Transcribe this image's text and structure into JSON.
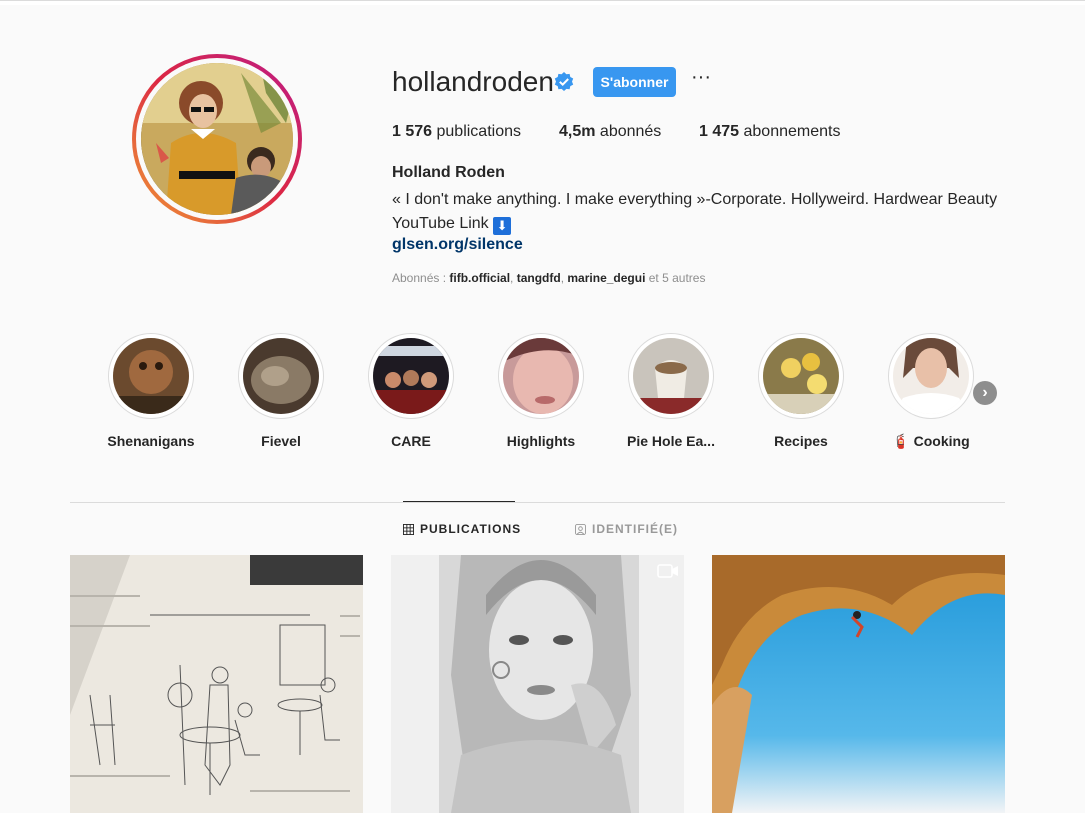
{
  "profile": {
    "username": "hollandroden",
    "follow_label": "S'abonner",
    "more_label": "···",
    "stats": {
      "posts_value": "1 576",
      "posts_label": " publications",
      "followers_value": "4,5m",
      "followers_label": " abonnés",
      "following_value": "1 475",
      "following_label": " abonnements"
    },
    "full_name": "Holland Roden",
    "bio_line1": "« I don't make anything. I make everything »-Corporate. Hollyweird. Hardwear Beauty",
    "bio_line2": "YouTube Link ",
    "bio_arrow": "⬇",
    "link": "glsen.org/silence",
    "followed_by_prefix": "Abonnés : ",
    "followed_by": [
      "fifb.official",
      "tangdfd",
      "marine_degui"
    ],
    "followed_by_sep1": ", ",
    "followed_by_sep2": ", ",
    "followed_by_suffix": " et 5 autres"
  },
  "highlights": [
    {
      "label": "Shenanigans"
    },
    {
      "label": "Fievel"
    },
    {
      "label": "CARE"
    },
    {
      "label": "Highlights"
    },
    {
      "label": "Pie Hole Ea..."
    },
    {
      "label": "Recipes"
    },
    {
      "label": "🧯 Cooking"
    }
  ],
  "highlights_next": "›",
  "tabs": {
    "publications": "PUBLICATIONS",
    "tagged": "IDENTIFIÉ(E)"
  },
  "colors": {
    "accent": "#3897f0",
    "link": "#003569",
    "verified": "#3897f0"
  }
}
